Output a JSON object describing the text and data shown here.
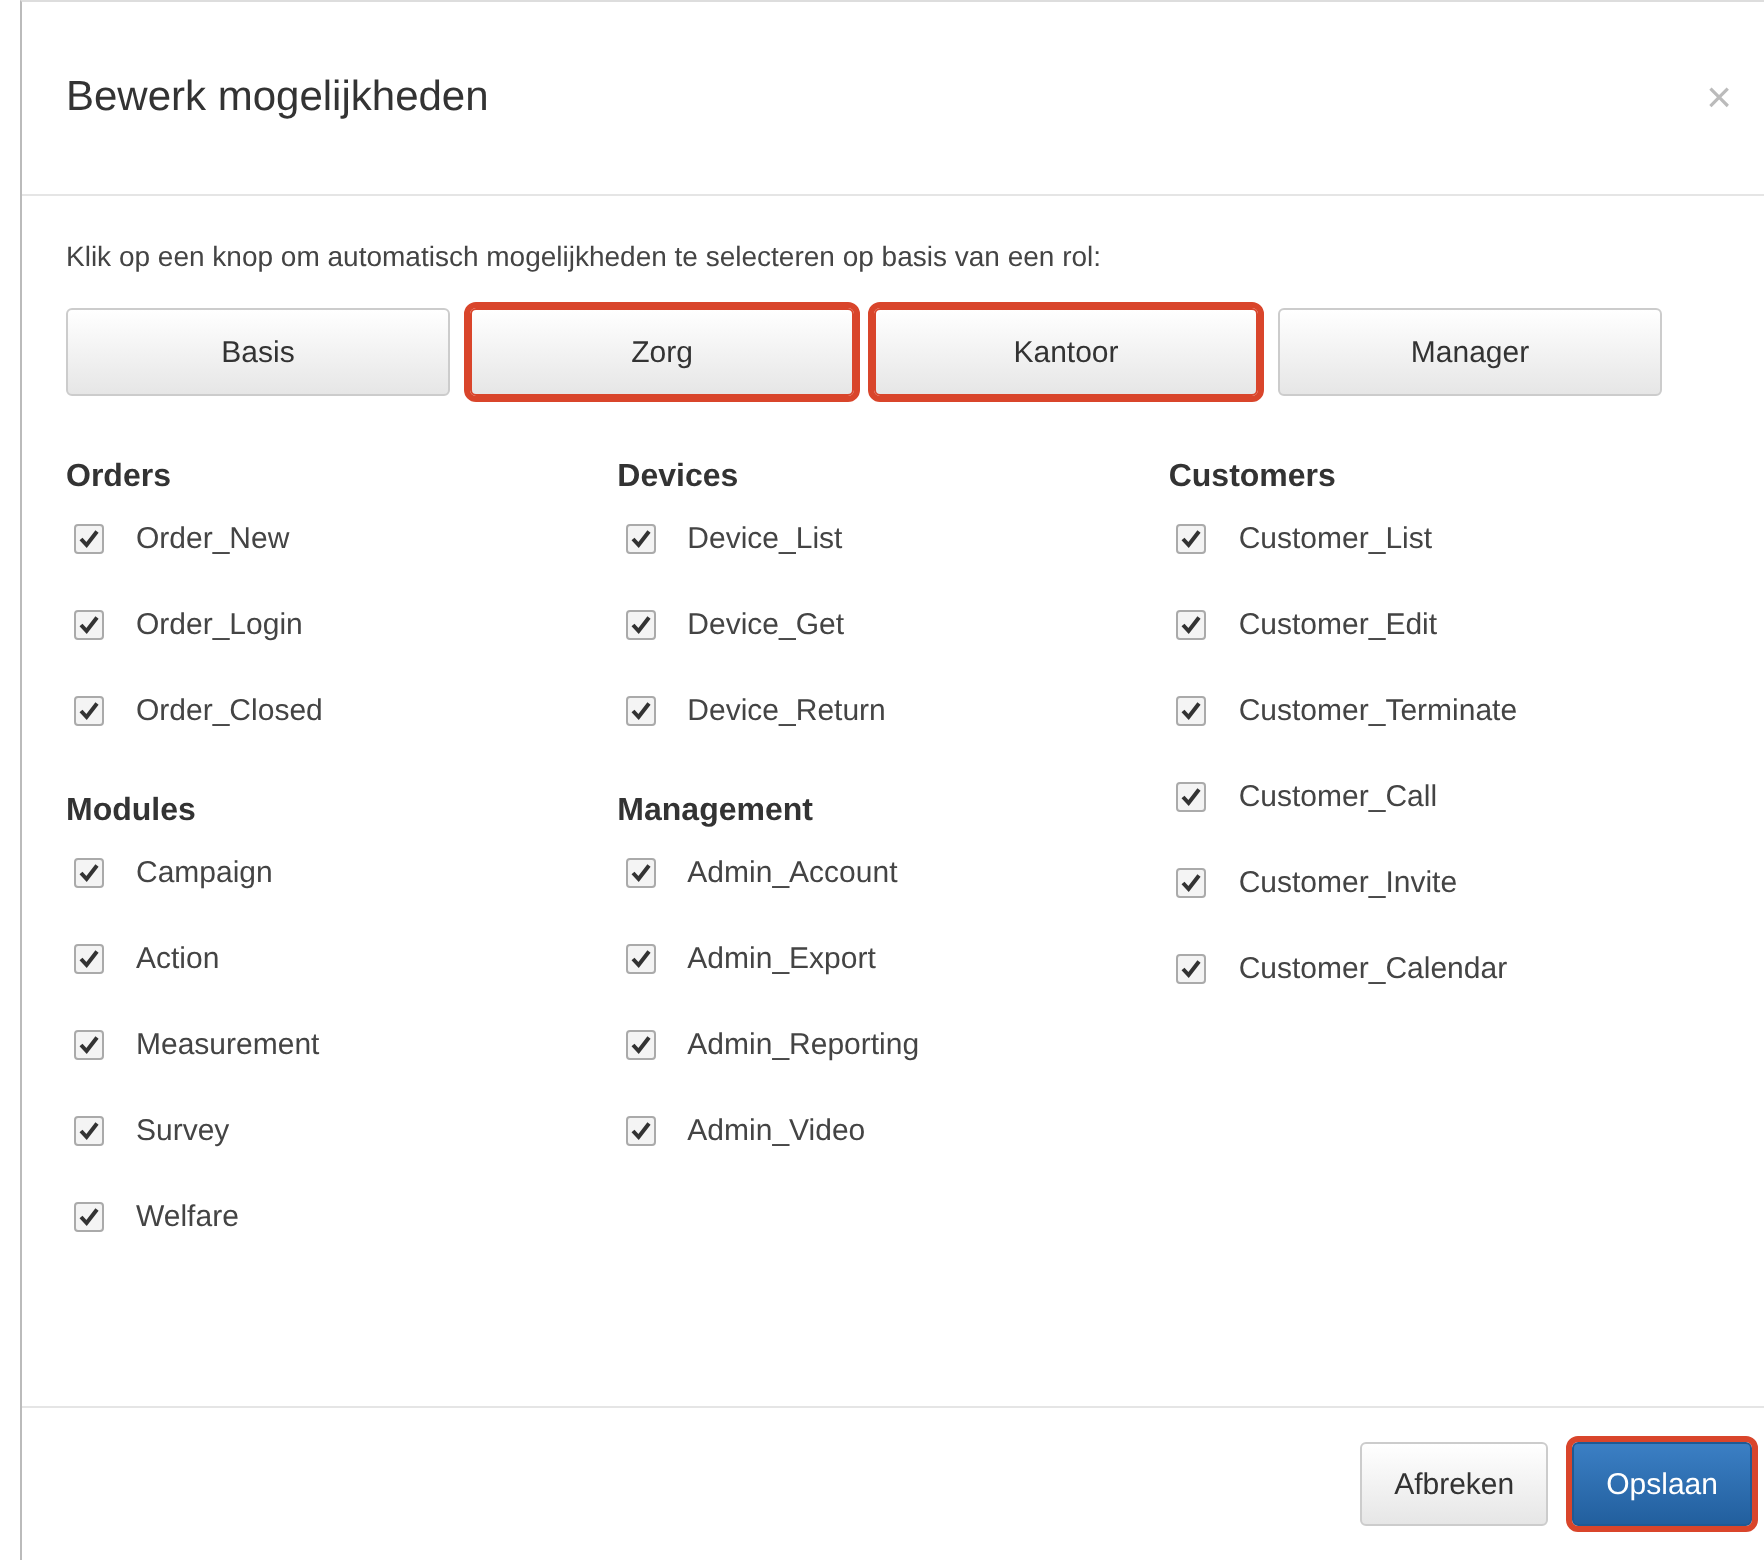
{
  "dialog": {
    "title": "Bewerk mogelijkheden",
    "close": "×"
  },
  "instruction": "Klik op een knop om automatisch mogelijkheden te selecteren op basis van een rol:",
  "role_buttons": [
    {
      "label": "Basis",
      "highlighted": false
    },
    {
      "label": "Zorg",
      "highlighted": true
    },
    {
      "label": "Kantoor",
      "highlighted": true
    },
    {
      "label": "Manager",
      "highlighted": false
    }
  ],
  "columns": [
    {
      "groups": [
        {
          "title": "Orders",
          "items": [
            {
              "label": "Order_New",
              "checked": true
            },
            {
              "label": "Order_Login",
              "checked": true
            },
            {
              "label": "Order_Closed",
              "checked": true
            }
          ]
        },
        {
          "title": "Modules",
          "items": [
            {
              "label": "Campaign",
              "checked": true
            },
            {
              "label": "Action",
              "checked": true
            },
            {
              "label": "Measurement",
              "checked": true
            },
            {
              "label": "Survey",
              "checked": true
            },
            {
              "label": "Welfare",
              "checked": true
            }
          ]
        }
      ]
    },
    {
      "groups": [
        {
          "title": "Devices",
          "items": [
            {
              "label": "Device_List",
              "checked": true
            },
            {
              "label": "Device_Get",
              "checked": true
            },
            {
              "label": "Device_Return",
              "checked": true
            }
          ]
        },
        {
          "title": "Management",
          "items": [
            {
              "label": "Admin_Account",
              "checked": true
            },
            {
              "label": "Admin_Export",
              "checked": true
            },
            {
              "label": "Admin_Reporting",
              "checked": true
            },
            {
              "label": "Admin_Video",
              "checked": true
            }
          ]
        }
      ]
    },
    {
      "groups": [
        {
          "title": "Customers",
          "items": [
            {
              "label": "Customer_List",
              "checked": true
            },
            {
              "label": "Customer_Edit",
              "checked": true
            },
            {
              "label": "Customer_Terminate",
              "checked": true
            },
            {
              "label": "Customer_Call",
              "checked": true
            },
            {
              "label": "Customer_Invite",
              "checked": true
            },
            {
              "label": "Customer_Calendar",
              "checked": true
            }
          ]
        }
      ]
    }
  ],
  "footer_buttons": [
    {
      "label": "Afbreken",
      "kind": "default",
      "highlighted": false
    },
    {
      "label": "Opslaan",
      "kind": "primary",
      "highlighted": true
    }
  ]
}
